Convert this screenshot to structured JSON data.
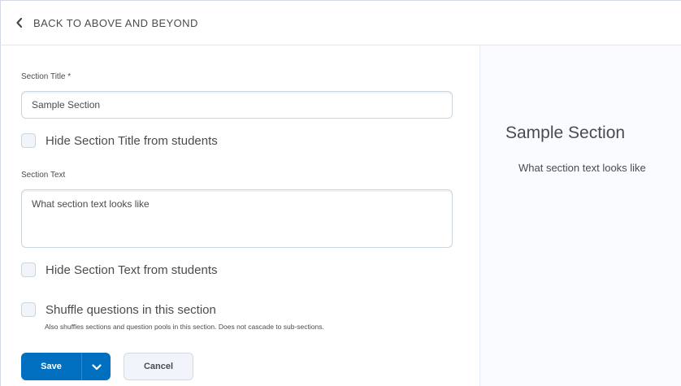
{
  "nav": {
    "back_label": "BACK TO ABOVE AND BEYOND",
    "back_icon": "chevron-left-icon"
  },
  "form": {
    "title_label": "Section Title *",
    "title_value": "Sample Section",
    "hide_title_label": "Hide Section Title from students",
    "hide_title_checked": false,
    "text_label": "Section Text",
    "text_value": "What section text looks like",
    "hide_text_label": "Hide Section Text from students",
    "hide_text_checked": false,
    "shuffle_label": "Shuffle questions in this section",
    "shuffle_checked": false,
    "shuffle_help": "Also shuffles sections and question pools in this section. Does not cascade to sub-sections."
  },
  "actions": {
    "save_label": "Save",
    "save_menu_icon": "chevron-down-icon",
    "cancel_label": "Cancel"
  },
  "preview": {
    "title": "Sample Section",
    "text": "What section text looks like"
  },
  "colors": {
    "primary": "#006fbf",
    "text": "#494c4e",
    "border": "#cdd5dc",
    "preview_bg": "#f9fbff"
  }
}
